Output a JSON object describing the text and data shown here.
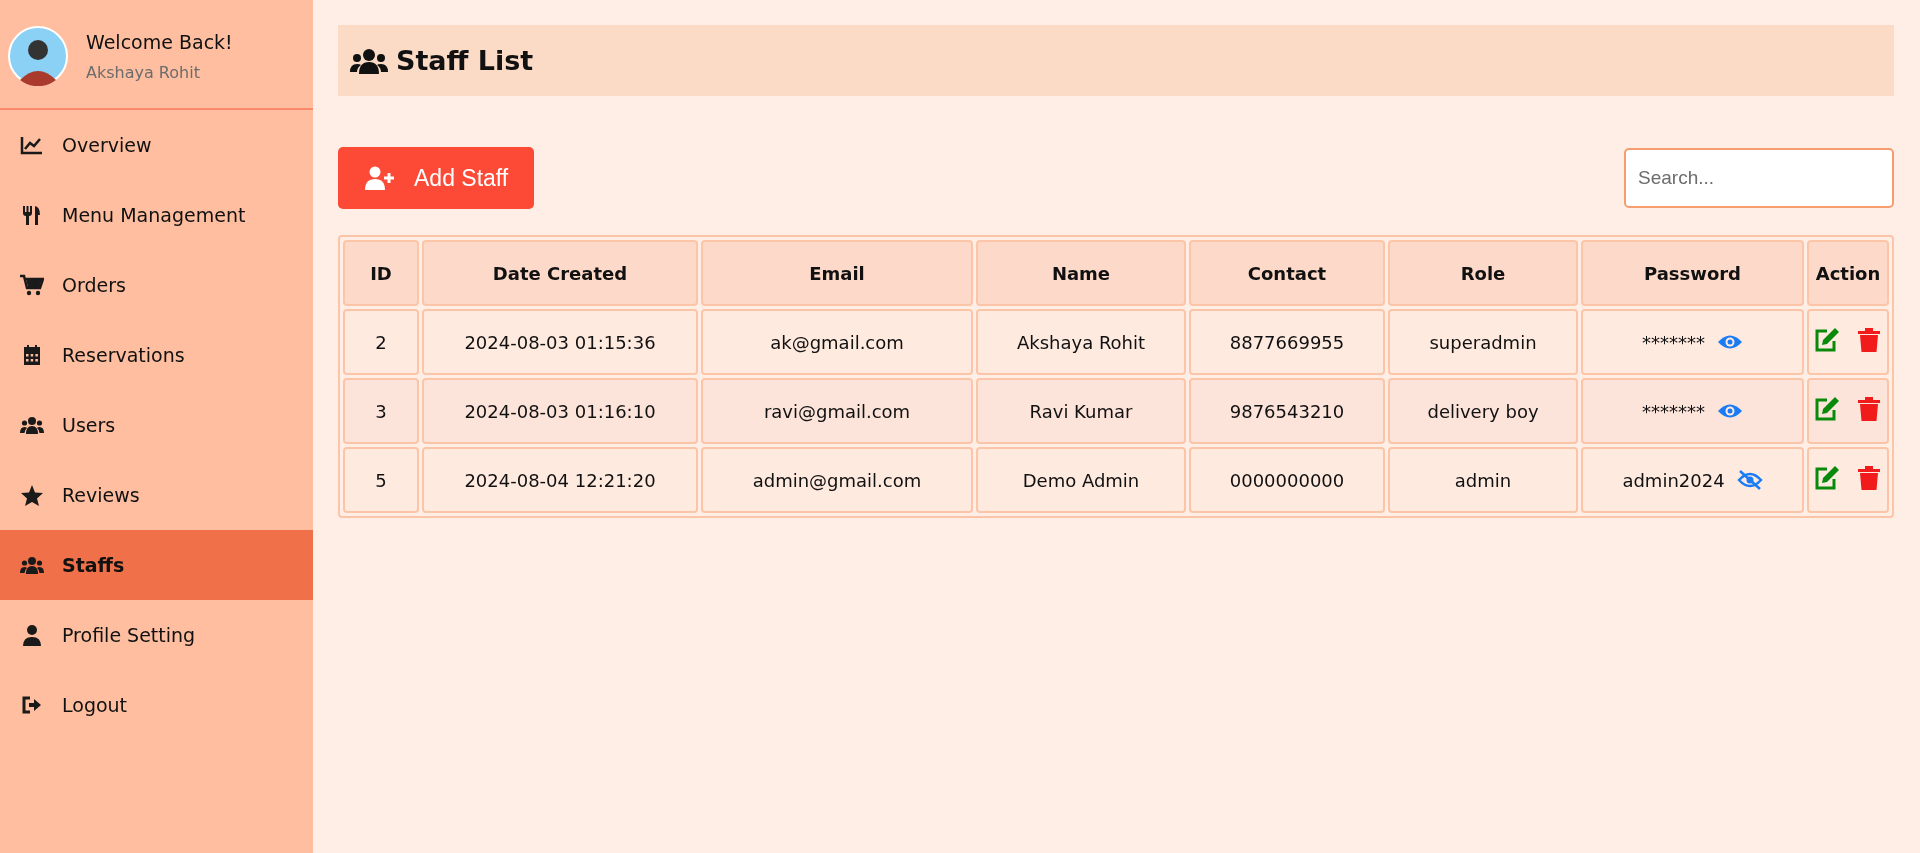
{
  "sidebar": {
    "greeting": "Welcome Back!",
    "user_name": "Akshaya Rohit",
    "items": [
      {
        "label": "Overview",
        "selected": false
      },
      {
        "label": "Menu Management",
        "selected": false
      },
      {
        "label": "Orders",
        "selected": false
      },
      {
        "label": "Reservations",
        "selected": false
      },
      {
        "label": "Users",
        "selected": false
      },
      {
        "label": "Reviews",
        "selected": false
      },
      {
        "label": "Staffs",
        "selected": true
      },
      {
        "label": "Profile Setting",
        "selected": false
      },
      {
        "label": "Logout",
        "selected": false
      }
    ]
  },
  "page_title": "Staff List",
  "add_button": "Add Staff",
  "search": {
    "placeholder": "Search..."
  },
  "table": {
    "columns": [
      "ID",
      "Date Created",
      "Email",
      "Name",
      "Contact",
      "Role",
      "Password",
      "Action"
    ],
    "rows": [
      {
        "id": "2",
        "date_created": "2024-08-03 01:15:36",
        "email": "ak@gmail.com",
        "name": "Akshaya Rohit",
        "contact": "8877669955",
        "role": "superadmin",
        "password": "*******",
        "revealed": false
      },
      {
        "id": "3",
        "date_created": "2024-08-03 01:16:10",
        "email": "ravi@gmail.com",
        "name": "Ravi Kumar",
        "contact": "9876543210",
        "role": "delivery boy",
        "password": "*******",
        "revealed": false
      },
      {
        "id": "5",
        "date_created": "2024-08-04 12:21:20",
        "email": "admin@gmail.com",
        "name": "Demo Admin",
        "contact": "0000000000",
        "role": "admin",
        "password": "admin2024",
        "revealed": true
      }
    ]
  }
}
